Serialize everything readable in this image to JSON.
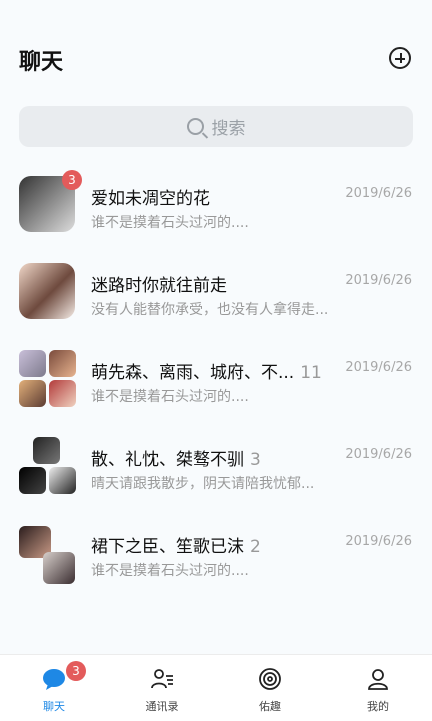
{
  "header": {
    "title": "聊天"
  },
  "search": {
    "placeholder": "搜索"
  },
  "chats": [
    {
      "name": "爱如未凋空的花",
      "count": "",
      "message": "谁不是摸着石头过河的....",
      "date": "2019/6/26",
      "badge": "3"
    },
    {
      "name": "迷路时你就往前走",
      "count": "",
      "message": "没有人能替你承受，也没有人拿得走...",
      "date": "2019/6/26",
      "badge": ""
    },
    {
      "name": "萌先森、离雨、城府、不...",
      "count": "11",
      "message": "谁不是摸着石头过河的....",
      "date": "2019/6/26",
      "badge": ""
    },
    {
      "name": "散、礼忱、桀骜不驯",
      "count": "3",
      "message": "晴天请跟我散步，阴天请陪我忧郁...",
      "date": "2019/6/26",
      "badge": ""
    },
    {
      "name": "裙下之臣、笙歌已沫",
      "count": "2",
      "message": "谁不是摸着石头过河的....",
      "date": "2019/6/26",
      "badge": ""
    }
  ],
  "tabs": [
    {
      "label": "聊天",
      "badge": "3"
    },
    {
      "label": "通讯录"
    },
    {
      "label": "佑趣"
    },
    {
      "label": "我的"
    }
  ],
  "colors": {
    "accent": "#1e88e5",
    "badge": "#e35b5b"
  }
}
